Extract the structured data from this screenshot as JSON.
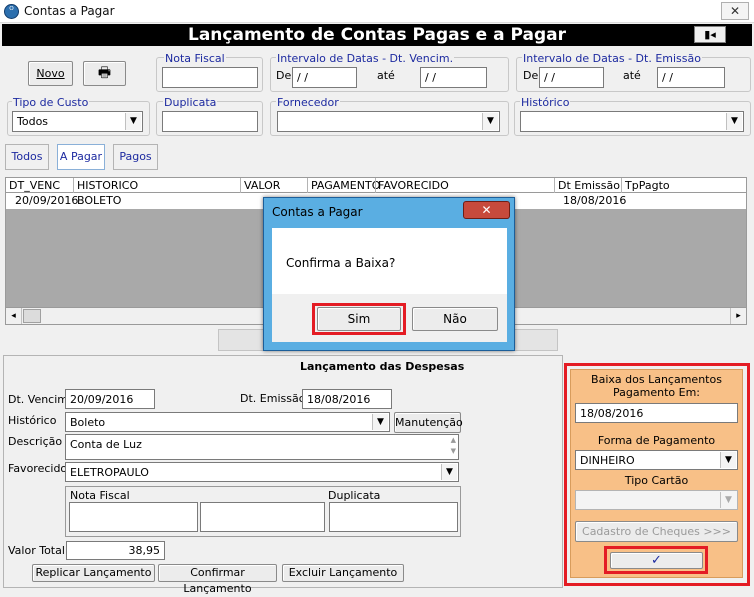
{
  "window": {
    "title": "Contas a Pagar",
    "app_icon": "ᴼ",
    "close_glyph": "✕"
  },
  "banner": {
    "title": "Lançamento de Contas Pagas e a Pagar",
    "exit_icon": "▮◂"
  },
  "toolbar": {
    "novo_label": "Novo",
    "print_icon": "🖶"
  },
  "filters": {
    "nota_fiscal": {
      "label": "Nota Fiscal",
      "value": ""
    },
    "venc_group": {
      "label": "Intervalo de Datas - Dt. Vencim.",
      "de_label": "De",
      "ate_label": "até",
      "de_value": " / /",
      "ate_value": " / /"
    },
    "emis_group": {
      "label": "Intervalo de Datas - Dt. Emissão",
      "de_label": "De",
      "ate_label": "até",
      "de_value": " / /",
      "ate_value": " / /"
    },
    "tipo_custo": {
      "label": "Tipo de Custo",
      "value": "Todos"
    },
    "duplicata": {
      "label": "Duplicata",
      "value": ""
    },
    "fornecedor": {
      "label": "Fornecedor",
      "value": ""
    },
    "historico": {
      "label": "Histórico",
      "value": ""
    }
  },
  "tabs": [
    {
      "label": "Todos"
    },
    {
      "label": "A Pagar"
    },
    {
      "label": "Pagos"
    }
  ],
  "grid": {
    "columns": [
      "DT_VENC",
      "HISTORICO",
      "VALOR",
      "PAGAMENTO",
      "FAVORECIDO",
      "Dt Emissão",
      "TpPagto"
    ],
    "rows": [
      [
        "20/09/2016",
        "BOLETO",
        "",
        "",
        "",
        "18/08/2016",
        ""
      ]
    ],
    "scroll_left": "◂",
    "scroll_right": "▸"
  },
  "lower": {
    "title": "Lançamento das Despesas",
    "dt_venc": {
      "label": "Dt. Vencim.",
      "value": "20/09/2016"
    },
    "dt_emissao": {
      "label": "Dt. Emissão",
      "value": "18/08/2016"
    },
    "historico": {
      "label": "Histórico",
      "value": "Boleto"
    },
    "manutencao_label": "Manutenção",
    "descricao": {
      "label": "Descrição",
      "value": "Conta de Luz"
    },
    "favorecido": {
      "label": "Favorecido",
      "value": "ELETROPAULO"
    },
    "nota_fiscal_label": "Nota Fiscal",
    "duplicata_label": "Duplicata",
    "valor_total": {
      "label": "Valor Total",
      "value": "38,95"
    },
    "buttons": {
      "replicar": "Replicar Lançamento",
      "confirmar": "Confirmar Lançamento",
      "excluir": "Excluir Lançamento"
    }
  },
  "baixa": {
    "title": "Baixa dos Lançamentos Pagamento  Em:",
    "date": "18/08/2016",
    "forma_label": "Forma de Pagamento",
    "forma_value": "DINHEIRO",
    "tipo_cartao_label": "Tipo Cartão",
    "tipo_cartao_value": "",
    "cheques_label": "Cadastro de Cheques >>>",
    "confirm_icon": "✓"
  },
  "dialog": {
    "title": "Contas a Pagar",
    "message": "Confirma a Baixa?",
    "yes": "Sim",
    "no": "Não",
    "close_glyph": "✕"
  },
  "colors": {
    "highlight": "#e41c24",
    "panel_orange": "#f8c087",
    "dialog_frame": "#5aaee2",
    "label_blue": "#1d2aa0"
  }
}
